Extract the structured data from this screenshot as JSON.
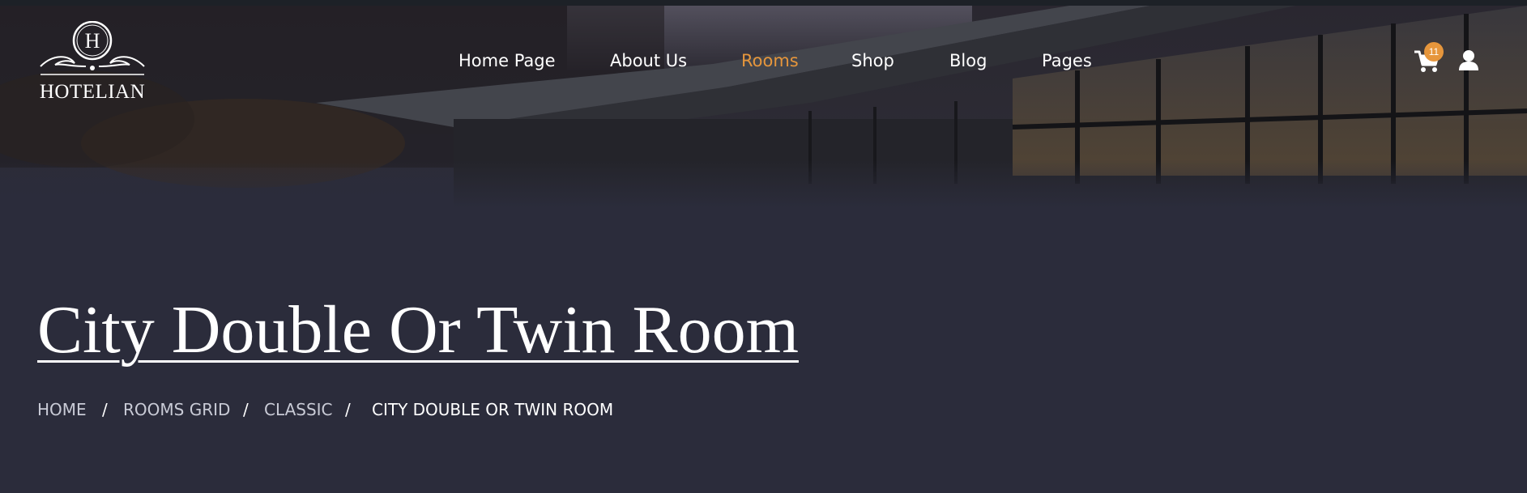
{
  "brand": {
    "name": "HOTELIAN",
    "monogram": "H"
  },
  "nav": {
    "items": [
      {
        "label": "Home Page"
      },
      {
        "label": "About Us"
      },
      {
        "label": "Rooms"
      },
      {
        "label": "Shop"
      },
      {
        "label": "Blog"
      },
      {
        "label": "Pages"
      }
    ],
    "active": "Rooms"
  },
  "header": {
    "cart_count": "11",
    "cart_icon": "cart-icon",
    "user_icon": "user-icon"
  },
  "page": {
    "title": "City Double Or Twin Room"
  },
  "breadcrumb": {
    "items": [
      "HOME",
      "ROOMS GRID",
      "CLASSIC",
      "CITY DOUBLE OR TWIN ROOM"
    ],
    "separator": "/"
  },
  "colors": {
    "accent": "#e6963c",
    "background": "#2b2c3b",
    "text": "#ffffff",
    "crumb": "#c9cbd6"
  }
}
